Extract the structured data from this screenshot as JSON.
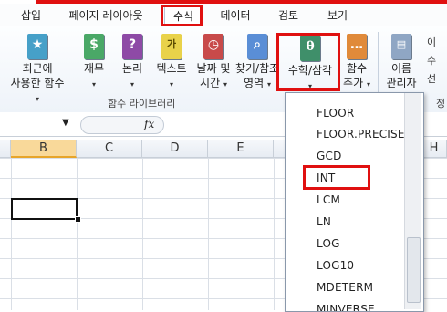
{
  "ribbon_tabs": [
    "삽입",
    "페이지 레이아웃",
    "수식",
    "데이터",
    "검토",
    "보기"
  ],
  "ribbon_buttons": {
    "recent": {
      "line1": "최근에",
      "line2": "사용한 함수"
    },
    "financial": {
      "line1": "재무"
    },
    "logical": {
      "line1": "논리"
    },
    "text": {
      "line1": "텍스트"
    },
    "datetime": {
      "line1": "날짜 및",
      "line2": "시간"
    },
    "lookup": {
      "line1": "찾기/참조",
      "line2": "영역"
    },
    "math": {
      "line1": "수학/삼각"
    },
    "more": {
      "line1": "함수",
      "line2": "추가"
    },
    "name_manager": {
      "line1": "이름",
      "line2": "관리자"
    }
  },
  "group_label": "함수 라이브러리",
  "right_fragments": {
    "a": "이",
    "b": "수",
    "c": "선",
    "d": "정"
  },
  "fx_label": "fx",
  "columns": [
    "B",
    "C",
    "D",
    "E",
    "H"
  ],
  "function_list": [
    "FLOOR",
    "FLOOR.PRECISE",
    "GCD",
    "INT",
    "LCM",
    "LN",
    "LOG",
    "LOG10",
    "MDETERM",
    "MINVERSE"
  ],
  "colors": {
    "accent": "#e01010",
    "selected_header": "#f9d99a",
    "ribbon": "#eef3f9"
  },
  "icons": [
    "book-star-icon",
    "book-money-icon",
    "book-question-icon",
    "book-text-icon",
    "book-clock-icon",
    "book-search-icon",
    "book-theta-icon",
    "book-more-icon",
    "name-manager-icon",
    "fx-icon"
  ]
}
